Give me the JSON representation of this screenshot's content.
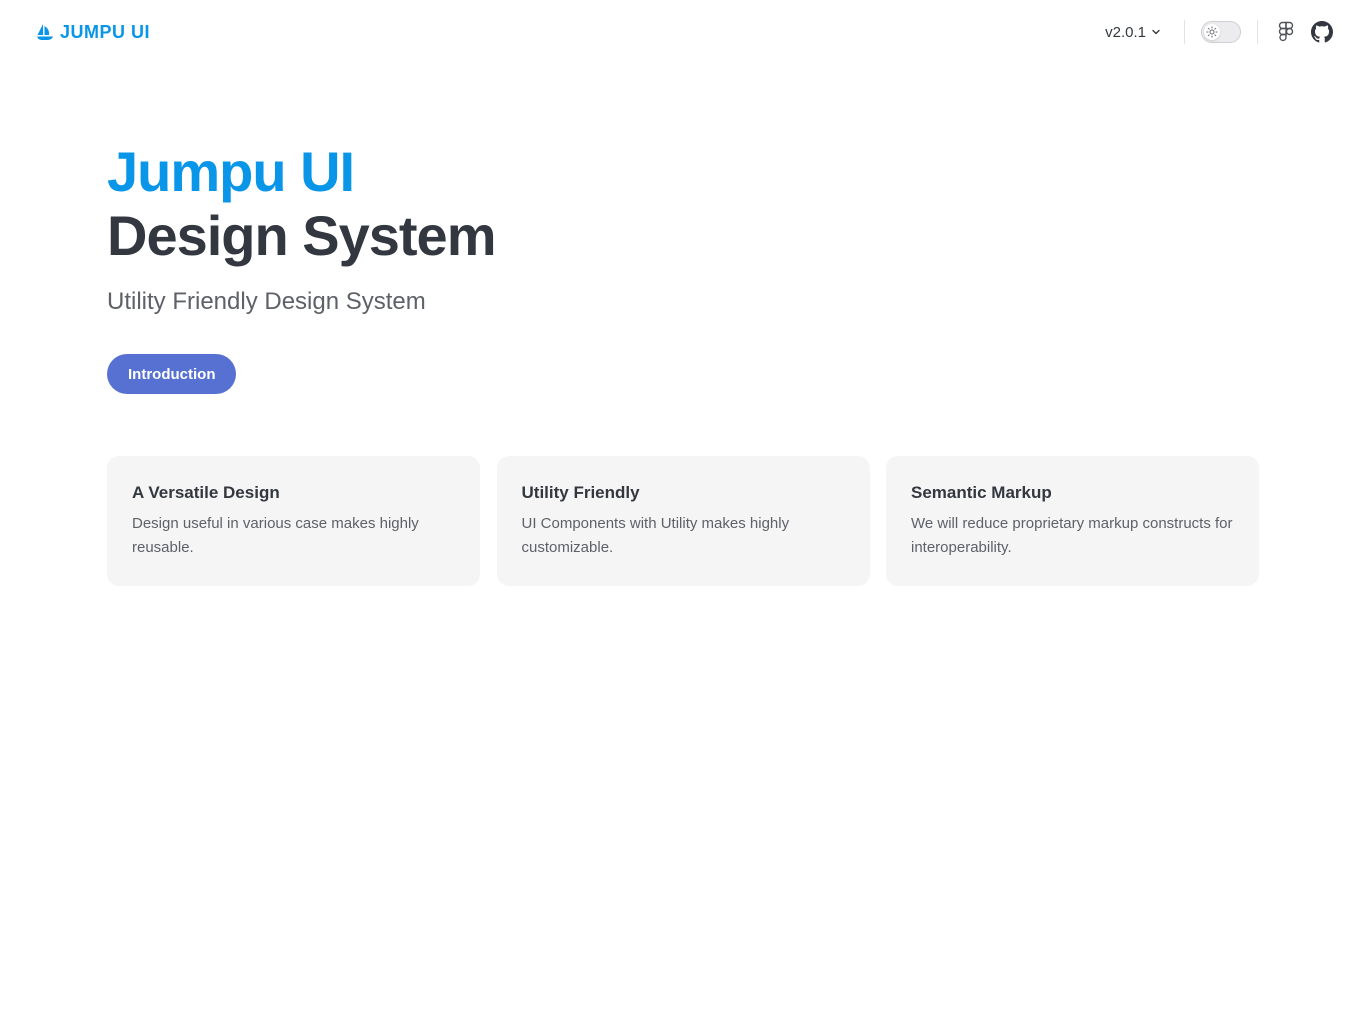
{
  "header": {
    "logo_text": "Jumpu UI",
    "version": "v2.0.1",
    "icons": {
      "logo": "sailboat-icon",
      "version_chevron": "chevron-down-icon",
      "theme": "sun-icon",
      "figma": "figma-icon",
      "github": "github-icon"
    }
  },
  "hero": {
    "title": "Jumpu UI",
    "subtitle": "Design System",
    "tagline": "Utility Friendly Design System",
    "button_label": "Introduction"
  },
  "features": [
    {
      "title": "A Versatile Design",
      "description": "Design useful in various case makes highly reusable."
    },
    {
      "title": "Utility Friendly",
      "description": "UI Components with Utility makes highly customizable."
    },
    {
      "title": "Semantic Markup",
      "description": "We will reduce proprietary markup constructs for interoperability."
    }
  ],
  "colors": {
    "brand": "#0995e8",
    "primary_button": "#5771d2",
    "text_dark": "#333840",
    "text_muted": "#5e6168",
    "card_bg": "#f5f5f5"
  }
}
